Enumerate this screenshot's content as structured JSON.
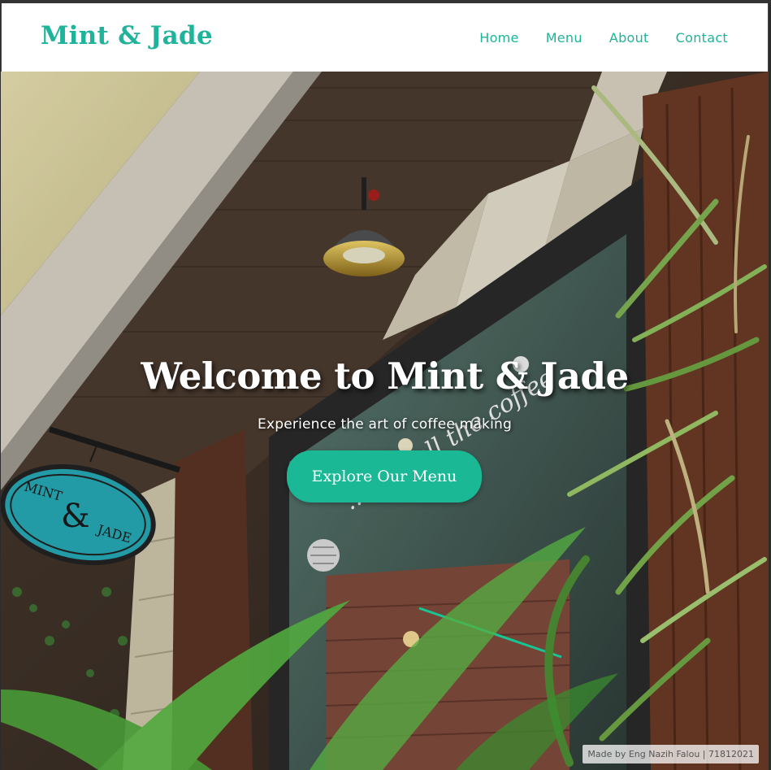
{
  "navbar": {
    "brand": "Mint & Jade",
    "links": [
      "Home",
      "Menu",
      "About",
      "Contact"
    ]
  },
  "hero": {
    "title": "Welcome to Mint & Jade",
    "subtitle": "Experience the art of coffee making",
    "cta_label": "Explore Our Menu",
    "sign_line1": "MINT",
    "sign_amp": "&",
    "sign_line2": "JADE",
    "window_script": "...d smell the coffee"
  },
  "footer": {
    "credit": "Made by Eng Nazih Falou | 71812021"
  },
  "colors": {
    "accent": "#1eb39a",
    "button": "#1bb896"
  }
}
